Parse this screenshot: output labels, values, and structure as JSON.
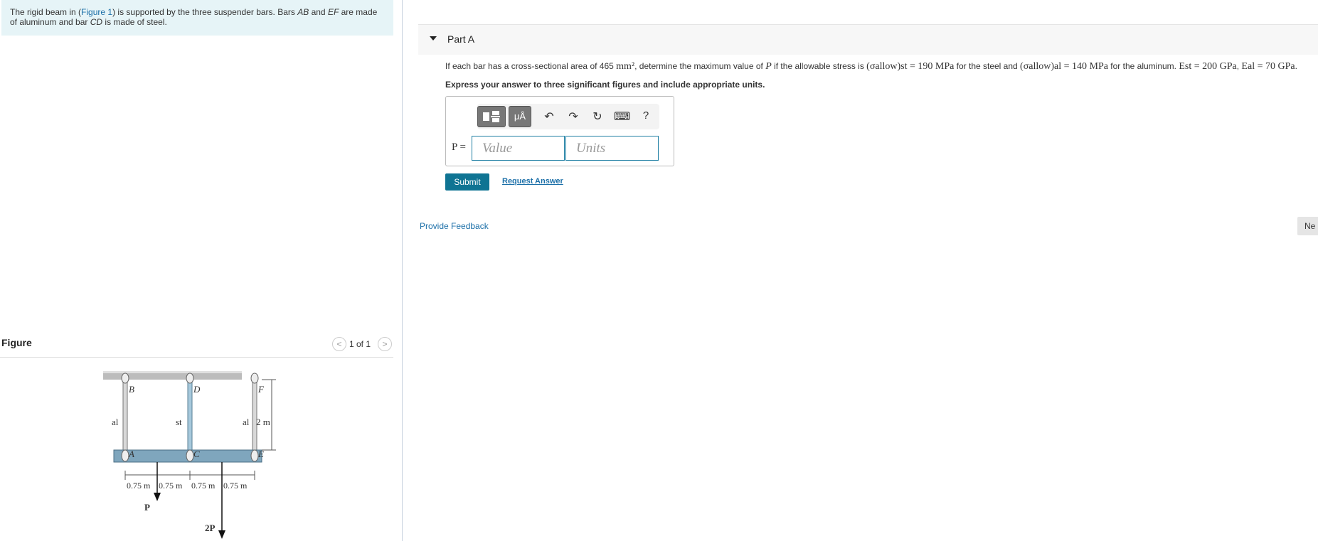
{
  "intro": {
    "before_link": "The rigid beam in (",
    "link": "Figure 1",
    "after_link": ") is supported by the three suspender bars. Bars ",
    "bar1": "AB",
    "mid1": " and ",
    "bar2": "EF",
    "mid2": " are made of aluminum and bar ",
    "bar3": "CD",
    "end": " is made of steel."
  },
  "figure": {
    "title": "Figure",
    "prev_icon": "<",
    "next_icon": ">",
    "pager": "1 of 1",
    "labels": {
      "B": "B",
      "D": "D",
      "F": "F",
      "A": "A",
      "C": "C",
      "E": "E",
      "al_left": "al",
      "st": "st",
      "al_right": "al",
      "height": "2 m",
      "d1": "0.75 m",
      "d2": "0.75 m",
      "d3": "0.75 m",
      "d4": "0.75 m",
      "P": "P",
      "twoP": "2P"
    }
  },
  "part": {
    "title": "Part A",
    "question_1": "If each bar has a cross-sectional area of 465 ",
    "area_unit": "mm²",
    "question_2": ", determine the maximum value of ",
    "P": "P",
    "question_3": " if the allowable stress is ",
    "sigma_st": "(σallow)st = 190 MPa",
    "question_4": " for the steel and ",
    "sigma_al": "(σallow)al = 140 MPa",
    "question_5": " for the aluminum. ",
    "E_st": "Est = 200 GPa",
    "comma": ", ",
    "E_al": "Eal = 70 GPa",
    "period": ".",
    "instruction": "Express your answer to three significant figures and include appropriate units.",
    "answer_label": "P =",
    "value_placeholder": "Value",
    "units_placeholder": "Units",
    "submit": "Submit",
    "request_answer": "Request Answer"
  },
  "toolbar": {
    "templates_icon": "templates-icon",
    "units_btn": "μÅ",
    "undo_icon": "↶",
    "redo_icon": "↷",
    "reset_icon": "↻",
    "keyboard_icon": "⌨",
    "help": "?"
  },
  "feedback": "Provide Feedback",
  "next": "Ne"
}
